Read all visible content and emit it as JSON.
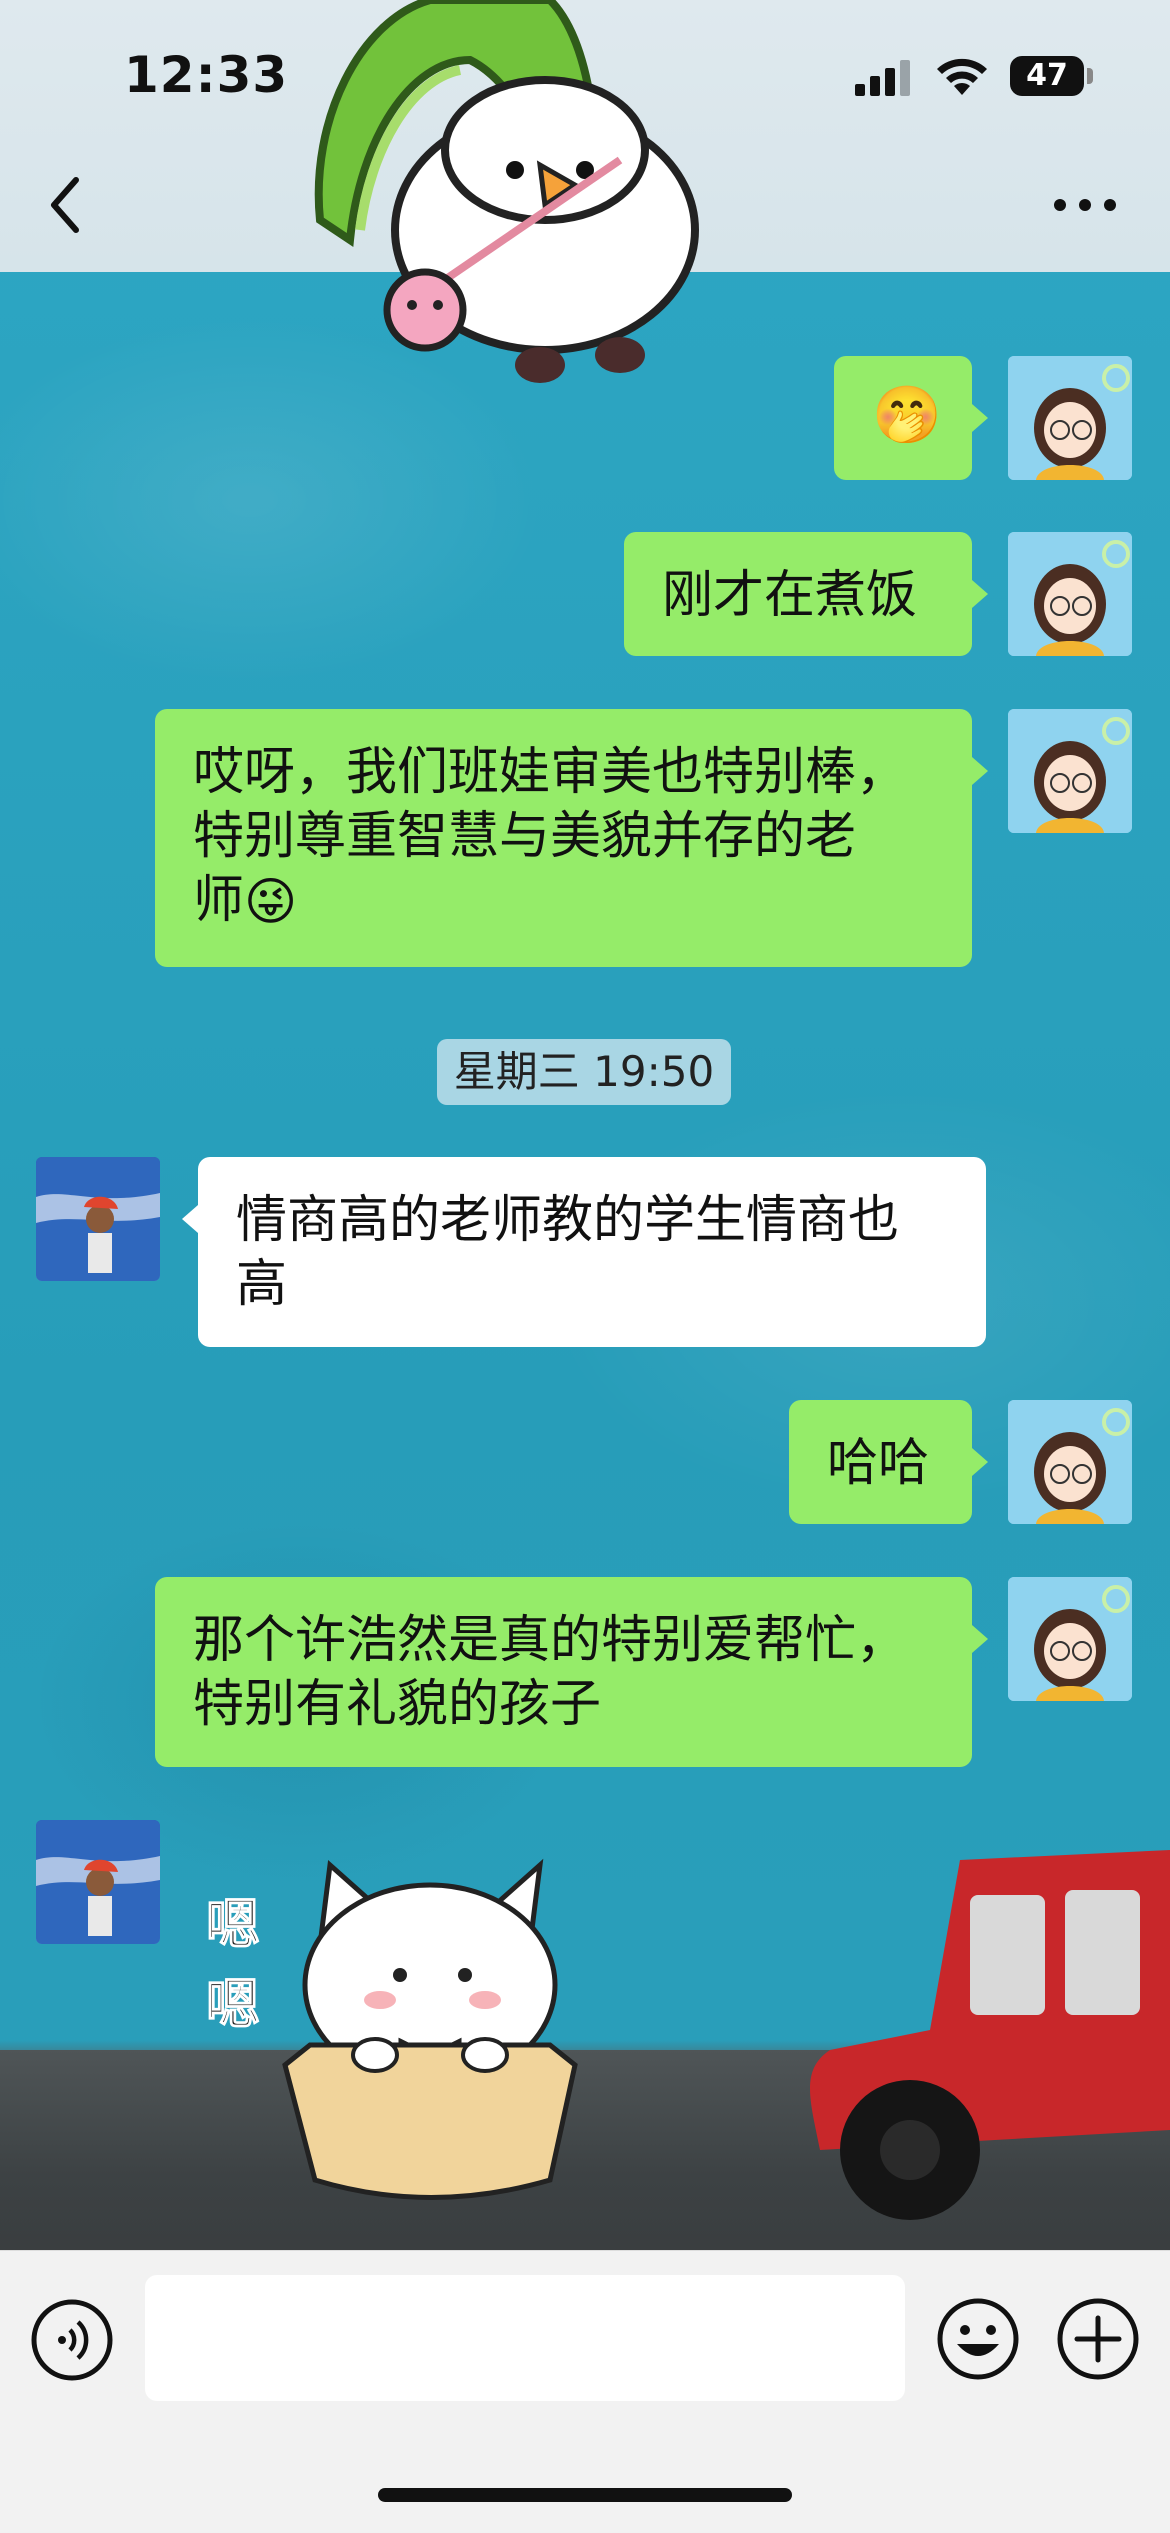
{
  "status_bar": {
    "time": "12:33",
    "battery": "47"
  },
  "header": {
    "back_icon": "chevron-left-icon",
    "more_icon": "ellipsis-icon"
  },
  "messages": [
    {
      "side": "me",
      "type": "emoji",
      "text": "🤭"
    },
    {
      "side": "me",
      "type": "text",
      "text": "刚才在煮饭"
    },
    {
      "side": "me",
      "type": "text",
      "text": "哎呀，我们班娃审美也特别棒，\n特别尊重智慧与美貌并存的老\n师",
      "emoji": "😜"
    },
    {
      "side": "other",
      "type": "text",
      "text": "情商高的老师教的学生情商也\n高"
    },
    {
      "side": "me",
      "type": "text",
      "text": "哈哈"
    },
    {
      "side": "me",
      "type": "text",
      "text": "那个许浩然是真的特别爱帮忙，\n特别有礼貌的孩子"
    },
    {
      "side": "other",
      "type": "sticker",
      "text": "嗯\n嗯"
    }
  ],
  "time_divider": "星期三 19:50",
  "input_bar": {
    "voice_icon": "voice-icon",
    "emoji_icon": "smiley-icon",
    "plus_icon": "plus-icon",
    "input_value": ""
  },
  "colors": {
    "my_bubble": "#95ec69",
    "other_bubble": "#ffffff",
    "chat_background": "#2aa0bd"
  }
}
